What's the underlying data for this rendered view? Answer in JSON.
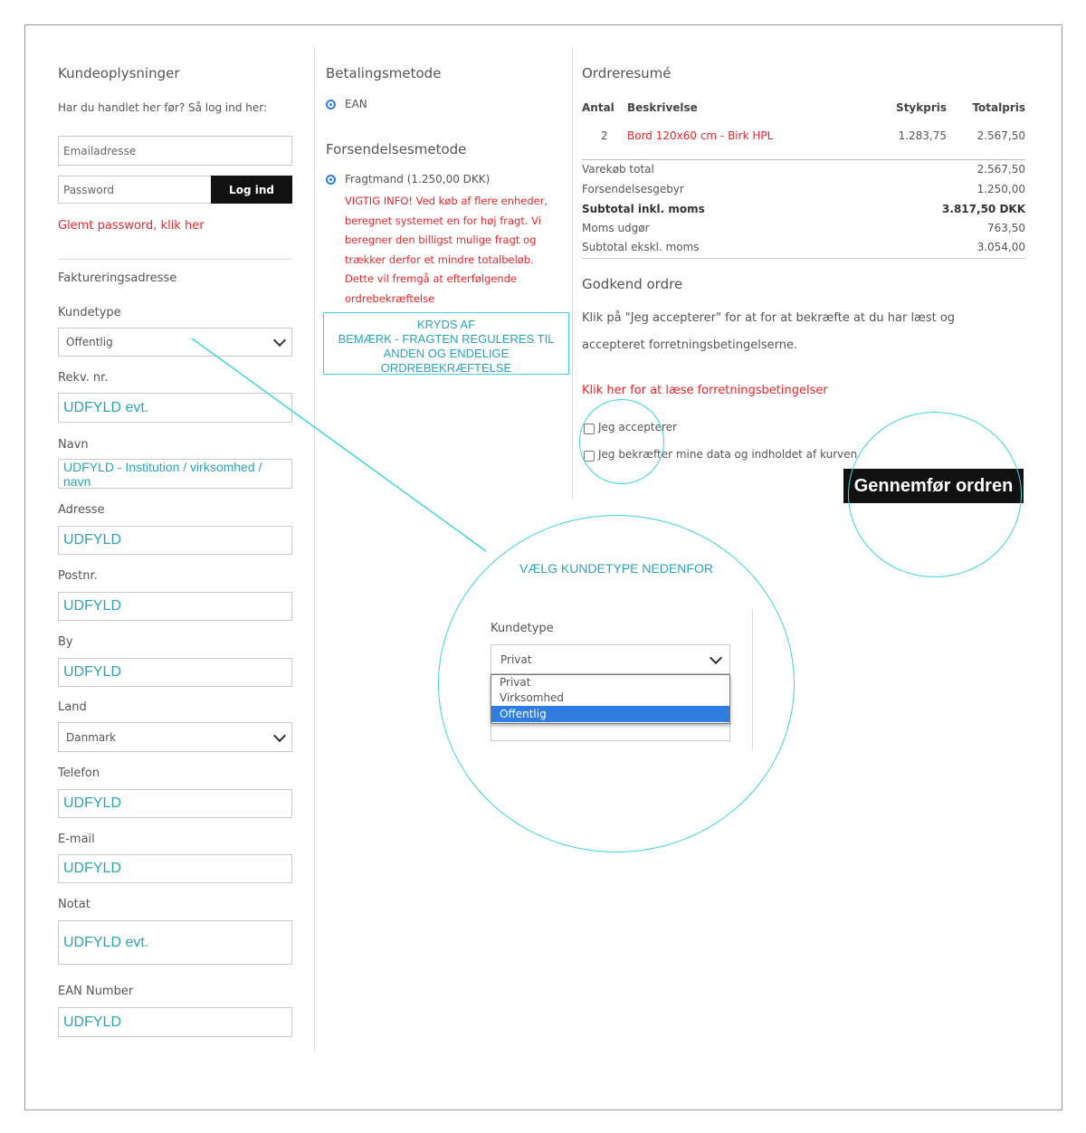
{
  "customer": {
    "title": "Kundeoplysninger",
    "login_prompt": "Har du handlet her før? Så log ind her:",
    "email_placeholder": "Emailadresse",
    "password_placeholder": "Password",
    "login_button": "Log ind",
    "forgot_password": "Glemt password, klik her",
    "billing_title": "Faktureringsadresse",
    "fields": {
      "kundetype_label": "Kundetype",
      "kundetype_value": "Offentlig",
      "rekv_label": "Rekv. nr.",
      "rekv_value": "UDFYLD evt.",
      "navn_label": "Navn",
      "navn_value": "UDFYLD - Institution / virksomhed / navn",
      "adresse_label": "Adresse",
      "adresse_value": "UDFYLD",
      "postnr_label": "Postnr.",
      "postnr_value": "UDFYLD",
      "by_label": "By",
      "by_value": "UDFYLD",
      "land_label": "Land",
      "land_value": "Danmark",
      "telefon_label": "Telefon",
      "telefon_value": "UDFYLD",
      "email_label": "E-mail",
      "email_value": "UDFYLD",
      "notat_label": "Notat",
      "notat_value": "UDFYLD evt.",
      "ean_label": "EAN Number",
      "ean_value": "UDFYLD"
    }
  },
  "payment": {
    "title": "Betalingsmetode",
    "option": "EAN",
    "shipping_title": "Forsendelsesmetode",
    "shipping_option": "Fragtmand (1.250,00 DKK)",
    "shipping_info": [
      "VIGTIG INFO! Ved køb af flere enheder,",
      "beregnet systemet en for høj fragt. Vi",
      "beregner den billigst mulige fragt og",
      "trækker derfor et mindre totalbeløb.",
      "Dette vil fremgå at efterfølgende",
      "ordrebekræftelse"
    ],
    "annotation": [
      "KRYDS AF",
      "BEMÆRK - FRAGTEN REGULERES TIL",
      "ANDEN OG ENDELIGE ORDREBEKRÆFTELSE"
    ]
  },
  "summary": {
    "title": "Ordreresumé",
    "headers": {
      "qty": "Antal",
      "desc": "Beskrivelse",
      "unit": "Stykpris",
      "total": "Totalpris"
    },
    "row": {
      "qty": "2",
      "desc": "Bord 120x60 cm - Birk HPL",
      "unit": "1.283,75",
      "total": "2.567,50"
    },
    "totals": [
      {
        "label": "Varekøb total",
        "value": "2.567,50"
      },
      {
        "label": "Forsendelsesgebyr",
        "value": "1.250,00"
      },
      {
        "label": "Subtotal inkl. moms",
        "value": "3.817,50 DKK"
      },
      {
        "label": "Moms udgør",
        "value": "763,50"
      },
      {
        "label": "Subtotal ekskl. moms",
        "value": "3.054,00"
      }
    ],
    "approve_title": "Godkend ordre",
    "approve_text_1": "Klik på \"Jeg accepterer\" for at for at bekræfte at du har læst og",
    "approve_text_2": "accepteret forretningsbetingelserne.",
    "terms_link": "Klik her for at læse forretningsbetingelser",
    "accept_label": "Jeg accepterer",
    "confirm_label": "Jeg bekræfter mine data og indholdet af kurven",
    "submit_button": "Gennemfør ordren"
  },
  "zoom": {
    "caption": "VÆLG KUNDETYPE NEDENFOR",
    "label": "Kundetype",
    "selected": "Privat",
    "options": [
      "Privat",
      "Virksomhed",
      "Offentlig"
    ],
    "highlighted_option": "Offentlig"
  },
  "colors": {
    "accent_red": "#e8262b",
    "annotation_cyan": "#3fd3e0",
    "radio_blue": "#2f7de1"
  }
}
